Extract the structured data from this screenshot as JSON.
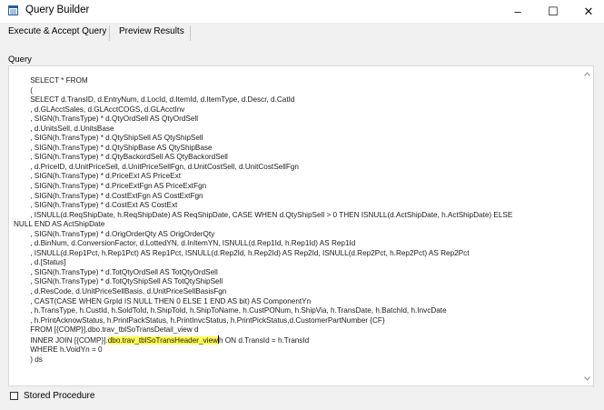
{
  "window": {
    "title": "Query Builder",
    "minimize_glyph": "–",
    "maximize_glyph": "☐",
    "close_glyph": "✕"
  },
  "toolbar": {
    "execute_label": "Execute & Accept Query",
    "preview_label": "Preview Results"
  },
  "query": {
    "label": "Query",
    "lines": [
      "        SELECT * FROM",
      "        (",
      "        SELECT d.TransID, d.EntryNum, d.LocId, d.ItemId, d.ItemType, d.Descr, d.CatId",
      "        , d.GLAcctSales, d.GLAcctCOGS, d.GLAcctInv",
      "        , SIGN(h.TransType) * d.QtyOrdSell AS QtyOrdSell",
      "        , d.UnitsSell, d.UnitsBase",
      "        , SIGN(h.TransType) * d.QtyShipSell AS QtyShipSell",
      "        , SIGN(h.TransType) * d.QtyShipBase AS QtyShipBase",
      "        , SIGN(h.TransType) * d.QtyBackordSell AS QtyBackordSell",
      "        , d.PriceID, d.UnitPriceSell, d.UnitPriceSellFgn, d.UnitCostSell, d.UnitCostSellFgn",
      "        , SIGN(h.TransType) * d.PriceExt AS PriceExt",
      "        , SIGN(h.TransType) * d.PriceExtFgn AS PriceExtFgn",
      "        , SIGN(h.TransType) * d.CostExtFgn AS CostExtFgn",
      "        , SIGN(h.TransType) * d.CostExt AS CostExt",
      "        , ISNULL(d.ReqShipDate, h.ReqShipDate) AS ReqShipDate, CASE WHEN d.QtyShipSell > 0 THEN ISNULL(d.ActShipDate, h.ActShipDate) ELSE",
      "NULL END AS ActShipDate",
      "        , SIGN(h.TransType) * d.OrigOrderQty AS OrigOrderQty",
      "        , d.BinNum, d.ConversionFactor, d.LottedYN, d.InItemYN, ISNULL(d.Rep1Id, h.Rep1Id) AS Rep1Id",
      "        , ISNULL(d.Rep1Pct, h.Rep1Pct) AS Rep1Pct, ISNULL(d.Rep2Id, h.Rep2Id) AS Rep2Id, ISNULL(d.Rep2Pct, h.Rep2Pct) AS Rep2Pct",
      "        , d.[Status]",
      "        , SIGN(h.TransType) * d.TotQtyOrdSell AS TotQtyOrdSell",
      "        , SIGN(h.TransType) * d.TotQtyShipSell AS TotQtyShipSell",
      "        , d.ResCode, d.UnitPriceSellBasis, d.UnitPriceSellBasisFgn",
      "        , CAST(CASE WHEN GrpId IS NULL THEN 0 ELSE 1 END AS bit) AS ComponentYn",
      "        , h.TransType, h.CustId, h.SoldToId, h.ShipToId, h.ShipToName, h.CustPONum, h.ShipVia, h.TransDate, h.BatchId, h.InvcDate",
      "        , h.PrintAcknowStatus, h.PrintPackStatus, h.PrintInvcStatus, h.PrintPickStatus,d.CustomerPartNumber {CF}",
      "        FROM [{COMP}].dbo.trav_tblSoTransDetail_view d"
    ],
    "join_before": "        INNER JOIN [{COMP}].",
    "join_highlight": "dbo.trav_tblSoTransHeader_view",
    "join_after": "h ON d.TransId = h.TransId",
    "tail_lines": [
      "        WHERE h.VoidYn = 0",
      "        ) ds"
    ]
  },
  "footer": {
    "stored_procedure_label": "Stored Procedure"
  }
}
